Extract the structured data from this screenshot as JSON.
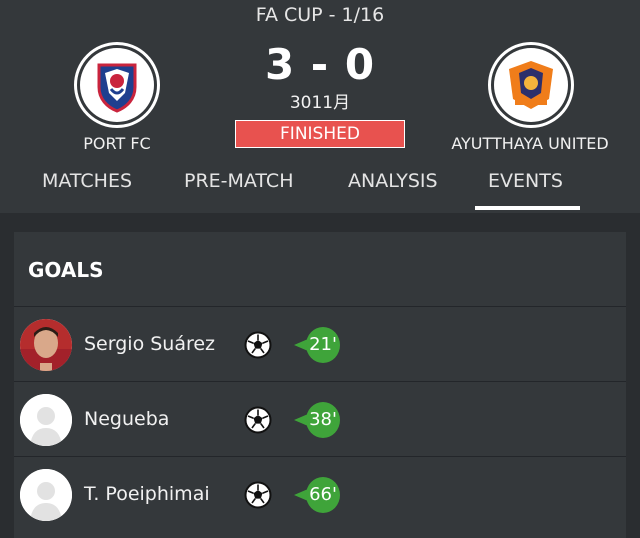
{
  "match": {
    "competition": "FA CUP - 1/16",
    "score": "3 - 0",
    "date": "3011月",
    "status": "FINISHED",
    "home_team": "PORT FC",
    "away_team": "AYUTTHAYA UNITED"
  },
  "tabs": [
    {
      "label": "MATCHES"
    },
    {
      "label": "PRE-MATCH"
    },
    {
      "label": "ANALYSIS"
    },
    {
      "label": "EVENTS",
      "active": true
    }
  ],
  "goals": {
    "title": "GOALS",
    "items": [
      {
        "player": "Sergio Suárez",
        "minute": "21'",
        "icon": "football-icon"
      },
      {
        "player": "Negueba",
        "minute": "38'",
        "icon": "football-icon"
      },
      {
        "player": "T. Poeiphimai",
        "minute": "66'",
        "icon": "football-icon"
      }
    ]
  },
  "colors": {
    "background": "#2a2d30",
    "panel": "#34383b",
    "status": "#e8524f",
    "minute_badge": "#3fa43a"
  }
}
